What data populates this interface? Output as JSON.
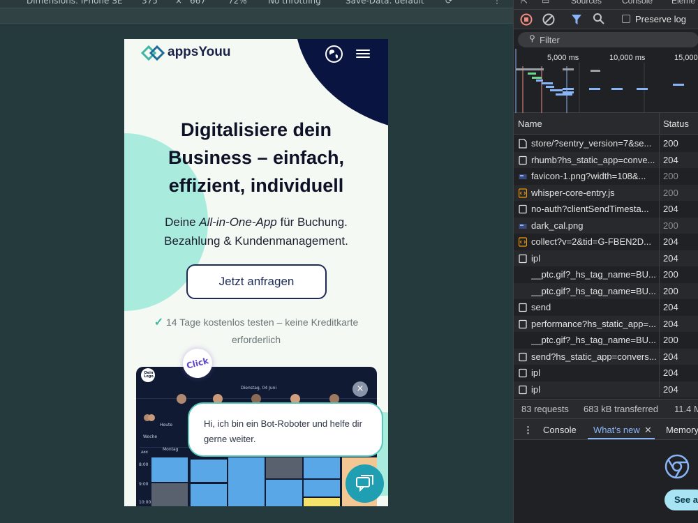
{
  "top_toolbar": {
    "dimensions": "Dimensions: iPhone SE",
    "width": "375",
    "times": "×",
    "height": "667",
    "zoom": "72%",
    "throttling": "No throttling",
    "save_data": "Save-Data: default"
  },
  "site": {
    "logo": "appsYouu",
    "hero_title_1": "Digitalisiere dein",
    "hero_title_2": "Business – einfach,",
    "hero_title_3": "effizient, individuell",
    "sub_prefix": "Deine ",
    "sub_em": "All-in-One-App",
    "sub_suffix": " für Buchung.",
    "sub_line2": "Bezahlung & Kundenmanagement.",
    "cta": "Jetzt anfragen",
    "trial_check": "✓",
    "trial_line1": " 14 Tage kostenlos testen – keine Kreditkarte",
    "trial_line2": "erforderlich",
    "click_badge": "Click",
    "card": {
      "logo": "Dein Logo",
      "date": "Dienstag, 04 Juni",
      "today": "Heute",
      "week": "Woche",
      "add": "Add",
      "day": "Montag",
      "times": [
        "8:00",
        "9:00",
        "10:00"
      ]
    },
    "bot_line1": "Hi, ich bin ein Bot-Roboter und helfe dir",
    "bot_line2": "gerne weiter.",
    "close": "×"
  },
  "devtools": {
    "top_tabs": [
      "Sources",
      "Console",
      "Eleme"
    ],
    "preserve_log": "Preserve log",
    "filter": "Filter",
    "overview_labels": [
      "5,000 ms",
      "10,000 ms",
      "15,000"
    ],
    "columns": {
      "name": "Name",
      "status": "Status"
    },
    "requests": [
      {
        "name": "store/?sentry_version=7&se...",
        "status": "200",
        "icon": "doc",
        "dim": false
      },
      {
        "name": "rhumb?hs_static_app=conve...",
        "status": "204",
        "icon": "box",
        "dim": false
      },
      {
        "name": "favicon-1.png?width=108&...",
        "status": "200",
        "icon": "img",
        "dim": true
      },
      {
        "name": "whisper-core-entry.js",
        "status": "200",
        "icon": "script",
        "dim": true
      },
      {
        "name": "no-auth?clientSendTimesta...",
        "status": "204",
        "icon": "box",
        "dim": false
      },
      {
        "name": "dark_cal.png",
        "status": "200",
        "icon": "img",
        "dim": true
      },
      {
        "name": "collect?v=2&tid=G-FBEN2D...",
        "status": "204",
        "icon": "script",
        "dim": false
      },
      {
        "name": "ipl",
        "status": "204",
        "icon": "box",
        "dim": false
      },
      {
        "name": "__ptc.gif?_hs_tag_name=BU...",
        "status": "200",
        "icon": "none",
        "dim": false
      },
      {
        "name": "__ptc.gif?_hs_tag_name=BU...",
        "status": "200",
        "icon": "none",
        "dim": false
      },
      {
        "name": "send",
        "status": "204",
        "icon": "box",
        "dim": false
      },
      {
        "name": "performance?hs_static_app=...",
        "status": "204",
        "icon": "box",
        "dim": false
      },
      {
        "name": "__ptc.gif?_hs_tag_name=BU...",
        "status": "200",
        "icon": "none",
        "dim": false
      },
      {
        "name": "send?hs_static_app=convers...",
        "status": "204",
        "icon": "box",
        "dim": false
      },
      {
        "name": "ipl",
        "status": "204",
        "icon": "box",
        "dim": false
      },
      {
        "name": "ipl",
        "status": "204",
        "icon": "box",
        "dim": false
      }
    ],
    "summary": {
      "requests": "83 requests",
      "transferred": "683 kB transferred",
      "resources": "11.4 M"
    },
    "drawer_tabs": {
      "console": "Console",
      "whats_new": "What's new",
      "memory": "Memory"
    },
    "see_all": "See al"
  },
  "colors": {
    "navy": "#0a1440",
    "mint": "#a9ecdd",
    "teal": "#1f9fb1",
    "accent_tab": "#8ab4f8"
  }
}
